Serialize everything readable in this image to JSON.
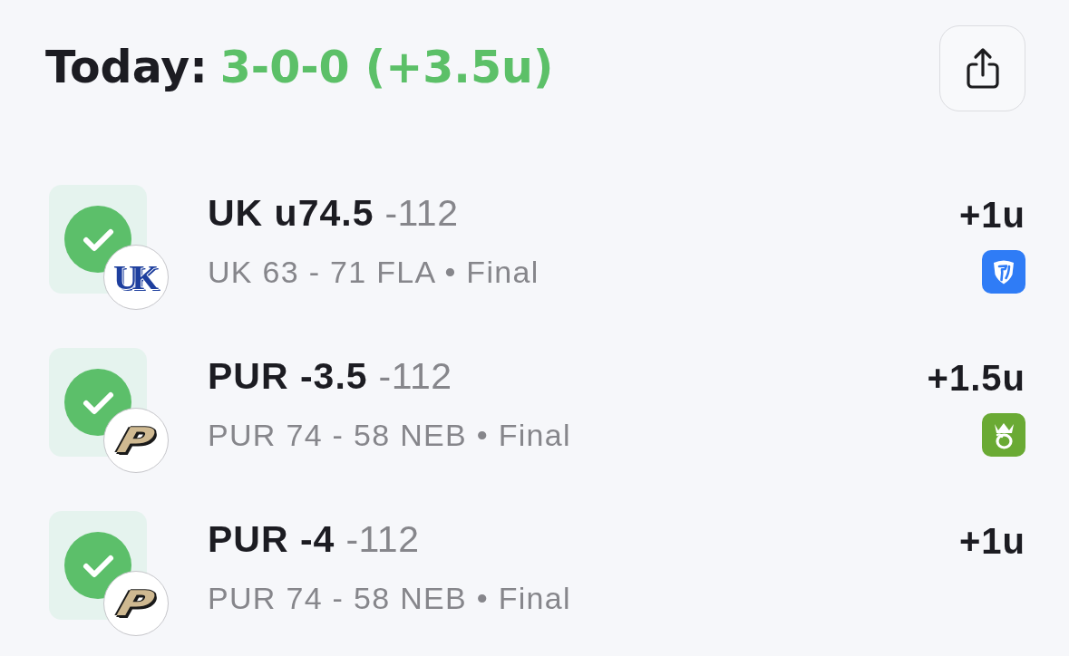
{
  "header": {
    "title": "Today:",
    "record": "3-0-0 (+3.5u)"
  },
  "bets": [
    {
      "kind": "win",
      "logo": {
        "kind": "block",
        "text": "UK"
      },
      "pick": "UK u74.5",
      "odds": "-112",
      "score": "UK 63 - 71 FLA • Final",
      "units": "+1u",
      "book": {
        "kind": "shield"
      }
    },
    {
      "kind": "win",
      "logo": {
        "kind": "slanted",
        "text": "P"
      },
      "pick": "PUR -3.5",
      "odds": "-112",
      "score": "PUR 74 - 58 NEB • Final",
      "units": "+1.5u",
      "book": {
        "kind": "crown"
      }
    },
    {
      "kind": "win",
      "logo": {
        "kind": "slanted",
        "text": "P"
      },
      "pick": "PUR -4",
      "odds": "-112",
      "score": "PUR 74 - 58 NEB • Final",
      "units": "+1u"
    }
  ]
}
